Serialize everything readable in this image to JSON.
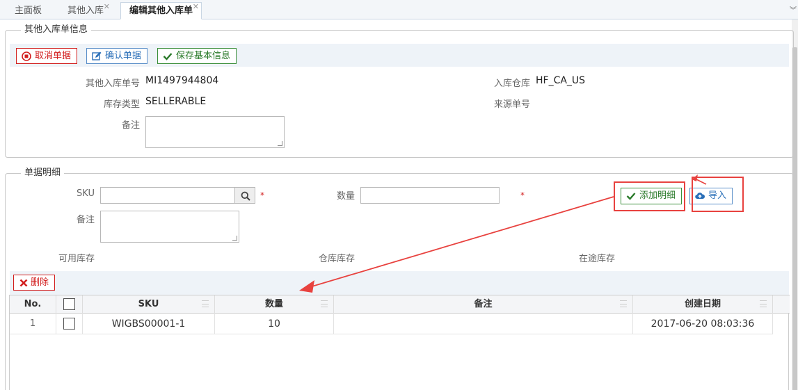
{
  "tabs": [
    {
      "label": "主面板",
      "closable": false,
      "active": false
    },
    {
      "label": "其他入库",
      "closable": true,
      "active": false
    },
    {
      "label": "编辑其他入库单",
      "closable": true,
      "active": true
    }
  ],
  "header_info": {
    "legend": "其他入库单信息",
    "buttons": {
      "cancel": "取消单据",
      "confirm": "确认单据",
      "save": "保存基本信息"
    },
    "fields": {
      "order_no_label": "其他入库单号",
      "order_no_value": "MI1497944804",
      "warehouse_label": "入库仓库",
      "warehouse_value": "HF_CA_US",
      "stock_type_label": "库存类型",
      "stock_type_value": "SELLERABLE",
      "source_no_label": "来源单号",
      "remark_label": "备注"
    }
  },
  "detail": {
    "legend": "单据明细",
    "sku_label": "SKU",
    "qty_label": "数量",
    "remark_label": "备注",
    "required_mark": "*",
    "add_button": "添加明细",
    "import_button": "导入",
    "available_stock_label": "可用库存",
    "warehouse_stock_label": "仓库库存",
    "transit_stock_label": "在途库存",
    "delete_button": "删除"
  },
  "grid": {
    "columns": [
      "No.",
      "",
      "SKU",
      "数量",
      "备注",
      "创建日期"
    ],
    "rows": [
      {
        "no": "1",
        "sku": "WIGBS00001-1",
        "qty": "10",
        "remark": "",
        "created": "2017-06-20 08:03:36"
      }
    ]
  },
  "colors": {
    "accent_red": "#d21f1f",
    "accent_blue": "#2a6fb8",
    "accent_green": "#2a7a2a",
    "annotation": "#e8423f"
  }
}
